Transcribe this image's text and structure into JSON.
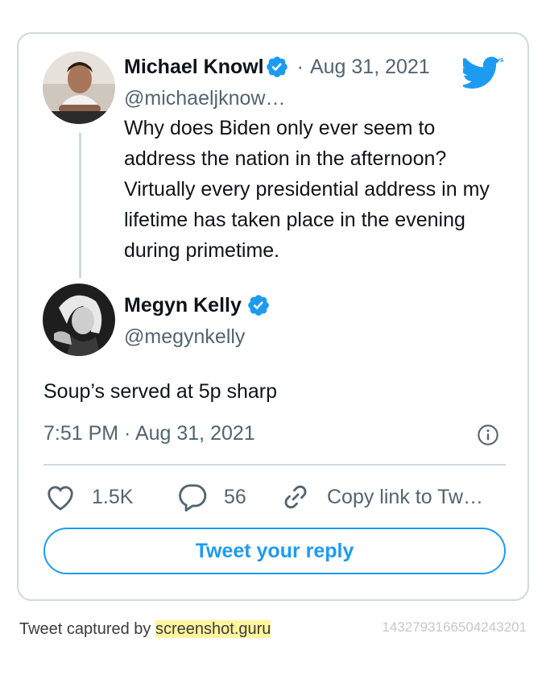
{
  "quoted_tweet": {
    "author_name": "Michael Knowl",
    "author_handle": "@michaeljknow…",
    "date_separator": "·",
    "date": "Aug 31, 2021",
    "text": "Why does Biden only ever seem to address the nation in the afternoon? Virtually every presidential address in my lifetime has taken place in the evening during primetime."
  },
  "main_tweet": {
    "author_name": "Megyn Kelly",
    "author_handle": "@megynkelly",
    "text": "Soup’s served at 5p sharp",
    "timestamp": "7:51 PM · Aug 31, 2021"
  },
  "actions": {
    "likes": "1.5K",
    "replies": "56",
    "copy_link": "Copy link to Tw…"
  },
  "reply_button": "Tweet your reply",
  "footer": {
    "captured_by": "Tweet captured by",
    "site": "screenshot.guru",
    "tweet_id": "1432793166504243201"
  },
  "colors": {
    "twitter_blue": "#1d9bf0",
    "border": "#cfd9de",
    "secondary_text": "#536471"
  },
  "icons": [
    "twitter-logo-icon",
    "verified-badge-icon",
    "info-icon",
    "heart-icon",
    "reply-bubble-icon",
    "link-icon"
  ]
}
